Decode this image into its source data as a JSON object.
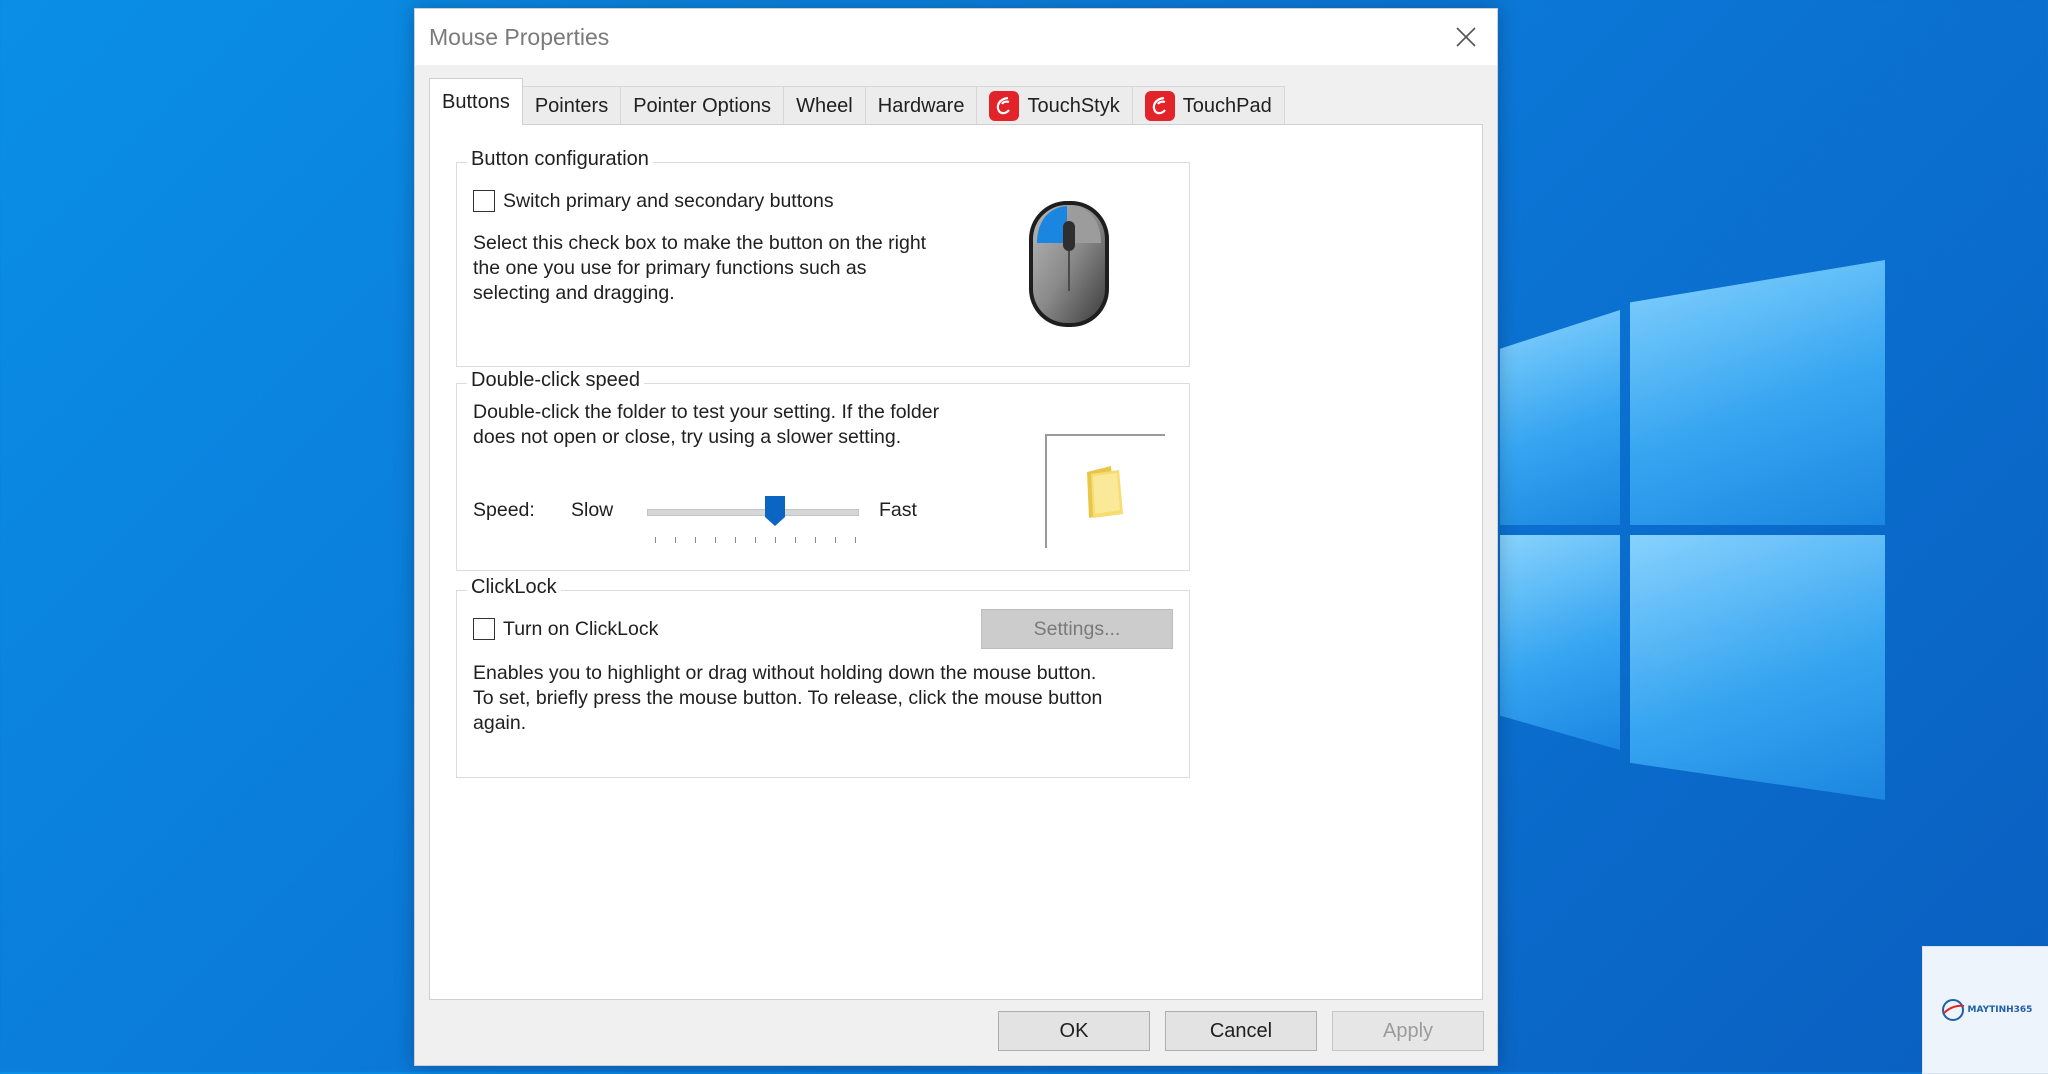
{
  "window": {
    "title": "Mouse Properties"
  },
  "tabs": [
    {
      "label": "Buttons",
      "active": true,
      "icon": ""
    },
    {
      "label": "Pointers",
      "active": false,
      "icon": ""
    },
    {
      "label": "Pointer Options",
      "active": false,
      "icon": ""
    },
    {
      "label": "Wheel",
      "active": false,
      "icon": ""
    },
    {
      "label": "Hardware",
      "active": false,
      "icon": ""
    },
    {
      "label": "TouchStyk",
      "active": false,
      "icon": "synaptics-logo-icon"
    },
    {
      "label": "TouchPad",
      "active": false,
      "icon": "synaptics-logo-icon"
    }
  ],
  "button_configuration": {
    "group_label": "Button configuration",
    "switch_label": "Switch primary and secondary buttons",
    "switch_checked": false,
    "description_lines": [
      "Select this check box to make the button on the right",
      "the one you use for primary functions such as",
      "selecting and dragging."
    ],
    "icon": "mouse-icon"
  },
  "double_click": {
    "group_label": "Double-click speed",
    "description_lines": [
      "Double-click the folder to test your setting. If the folder",
      "does not open or close, try using a slower setting."
    ],
    "speed_label": "Speed:",
    "slow_label": "Slow",
    "fast_label": "Fast",
    "slider_value": 0.6,
    "tick_count": 11,
    "test_icon": "folder-icon"
  },
  "clicklock": {
    "group_label": "ClickLock",
    "toggle_label": "Turn on ClickLock",
    "toggle_checked": false,
    "settings_label": "Settings...",
    "description_lines": [
      "Enables you to highlight or drag without holding down the mouse button.",
      "To set, briefly press the mouse button. To release, click the mouse button",
      "again."
    ]
  },
  "footer": {
    "ok_label": "OK",
    "cancel_label": "Cancel",
    "apply_label": "Apply"
  },
  "watermark": {
    "text": "MAYTINH365"
  },
  "colors": {
    "accent": "#0a66c2",
    "wallpaper": "#0b79d8",
    "synaptics_red": "#e3232a"
  }
}
